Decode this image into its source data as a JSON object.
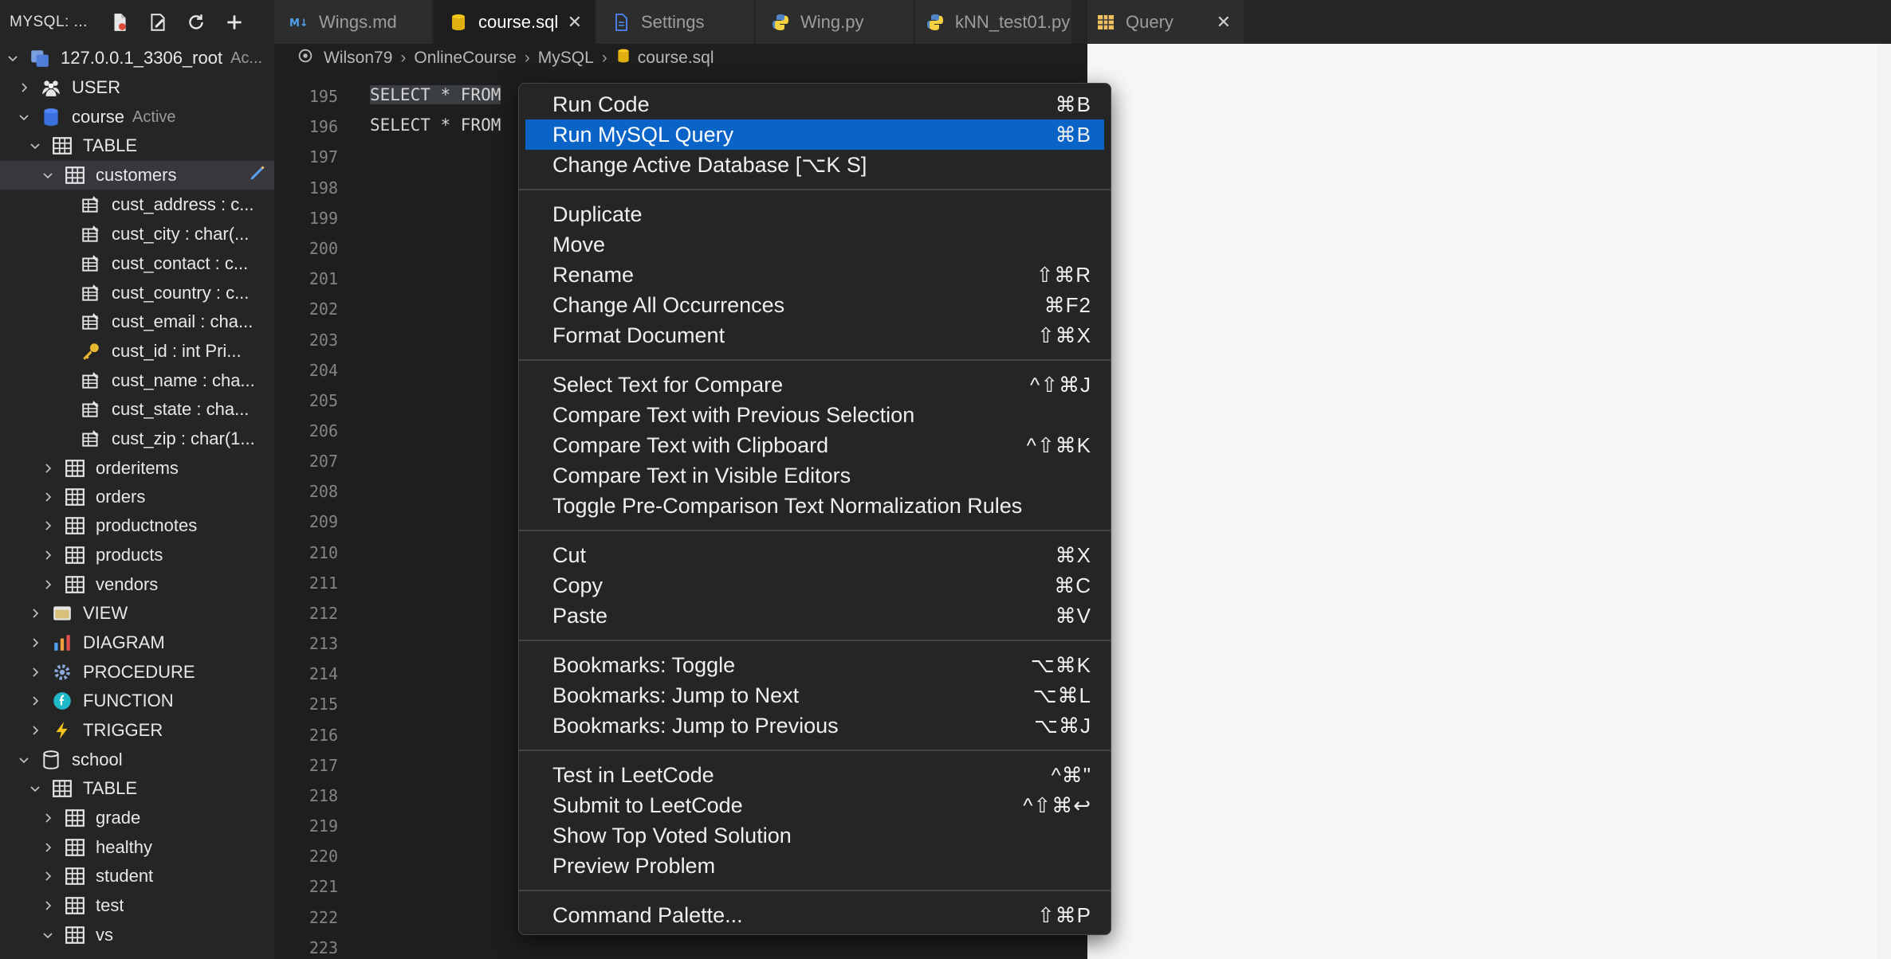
{
  "sidebar": {
    "title": "MYSQL: ...",
    "rows": [
      {
        "label": "127.0.0.1_3306_root",
        "sub": "Ac...",
        "icon": "server-icon"
      },
      {
        "label": "USER",
        "icon": "users-icon"
      },
      {
        "label": "course",
        "sub": "Active",
        "icon": "database-icon"
      },
      {
        "label": "TABLE",
        "icon": "table-icon"
      },
      {
        "label": "customers",
        "icon": "table-icon"
      },
      {
        "label": "cust_address : c...",
        "icon": "column-icon"
      },
      {
        "label": "cust_city : char(...",
        "icon": "column-icon"
      },
      {
        "label": "cust_contact : c...",
        "icon": "column-icon"
      },
      {
        "label": "cust_country : c...",
        "icon": "column-icon"
      },
      {
        "label": "cust_email : cha...",
        "icon": "column-icon"
      },
      {
        "label": "cust_id : int  Pri...",
        "icon": "key-icon"
      },
      {
        "label": "cust_name : cha...",
        "icon": "column-icon"
      },
      {
        "label": "cust_state : cha...",
        "icon": "column-icon"
      },
      {
        "label": "cust_zip : char(1...",
        "icon": "column-icon"
      },
      {
        "label": "orderitems",
        "icon": "table-icon"
      },
      {
        "label": "orders",
        "icon": "table-icon"
      },
      {
        "label": "productnotes",
        "icon": "table-icon"
      },
      {
        "label": "products",
        "icon": "table-icon"
      },
      {
        "label": "vendors",
        "icon": "table-icon"
      },
      {
        "label": "VIEW",
        "icon": "view-icon"
      },
      {
        "label": "DIAGRAM",
        "icon": "diagram-icon"
      },
      {
        "label": "PROCEDURE",
        "icon": "gear-icon"
      },
      {
        "label": "FUNCTION",
        "icon": "function-icon"
      },
      {
        "label": "TRIGGER",
        "icon": "lightning-icon"
      },
      {
        "label": "school",
        "icon": "database-icon"
      },
      {
        "label": "TABLE",
        "icon": "table-icon"
      },
      {
        "label": "grade",
        "icon": "table-icon"
      },
      {
        "label": "healthy",
        "icon": "table-icon"
      },
      {
        "label": "student",
        "icon": "table-icon"
      },
      {
        "label": "test",
        "icon": "table-icon"
      },
      {
        "label": "vs",
        "icon": "table-icon"
      }
    ]
  },
  "tabs": [
    {
      "label": "Wings.md",
      "icon": "markdown-icon"
    },
    {
      "label": "course.sql",
      "icon": "database-icon",
      "active": true
    },
    {
      "label": "Settings",
      "icon": "file-icon"
    },
    {
      "label": "Wing.py",
      "icon": "python-icon"
    },
    {
      "label": "kNN_test01.py",
      "icon": "python-icon"
    },
    {
      "label": "Query",
      "icon": "table-icon"
    }
  ],
  "breadcrumb": [
    "Wilson79",
    "OnlineCourse",
    "MySQL",
    "course.sql"
  ],
  "editor": {
    "line_numbers": [
      "195",
      "196",
      "197",
      "198",
      "199",
      "200",
      "201",
      "202",
      "203",
      "204",
      "205",
      "206",
      "207",
      "208",
      "209",
      "210",
      "211",
      "212",
      "213",
      "214",
      "215",
      "216",
      "217",
      "218",
      "219",
      "220",
      "221",
      "222",
      "223"
    ],
    "code_lines": [
      "SELECT * FROM",
      "SELECT * FROM"
    ]
  },
  "context_menu": {
    "items": [
      {
        "label": "Run Code",
        "shortcut": "⌘B"
      },
      {
        "label": "Run MySQL Query",
        "shortcut": "⌘B",
        "highlight": true
      },
      {
        "label": "Change Active Database [⌥K S]",
        "shortcut": ""
      },
      {
        "label": "Duplicate",
        "shortcut": ""
      },
      {
        "label": "Move",
        "shortcut": ""
      },
      {
        "label": "Rename",
        "shortcut": "⇧⌘R"
      },
      {
        "label": "Change All Occurrences",
        "shortcut": "⌘F2"
      },
      {
        "label": "Format Document",
        "shortcut": "⇧⌘X"
      },
      {
        "label": "Select Text for Compare",
        "shortcut": "^⇧⌘J"
      },
      {
        "label": "Compare Text with Previous Selection",
        "shortcut": ""
      },
      {
        "label": "Compare Text with Clipboard",
        "shortcut": "^⇧⌘K"
      },
      {
        "label": "Compare Text in Visible Editors",
        "shortcut": ""
      },
      {
        "label": "Toggle Pre-Comparison Text Normalization Rules",
        "shortcut": ""
      },
      {
        "label": "Cut",
        "shortcut": "⌘X"
      },
      {
        "label": "Copy",
        "shortcut": "⌘C"
      },
      {
        "label": "Paste",
        "shortcut": "⌘V"
      },
      {
        "label": "Bookmarks: Toggle",
        "shortcut": "⌥⌘K"
      },
      {
        "label": "Bookmarks: Jump to Next",
        "shortcut": "⌥⌘L"
      },
      {
        "label": "Bookmarks: Jump to Previous",
        "shortcut": "⌥⌘J"
      },
      {
        "label": "Test in LeetCode",
        "shortcut": "^⌘\""
      },
      {
        "label": "Submit to LeetCode",
        "shortcut": "^⇧⌘↩"
      },
      {
        "label": "Show Top Voted Solution",
        "shortcut": ""
      },
      {
        "label": "Preview Problem",
        "shortcut": ""
      },
      {
        "label": "Command Palette...",
        "shortcut": "⇧⌘P"
      }
    ]
  },
  "colors": {
    "accent": "#0a64c8",
    "sidebar_bg": "#252526",
    "editor_bg": "#1e1e1e"
  }
}
